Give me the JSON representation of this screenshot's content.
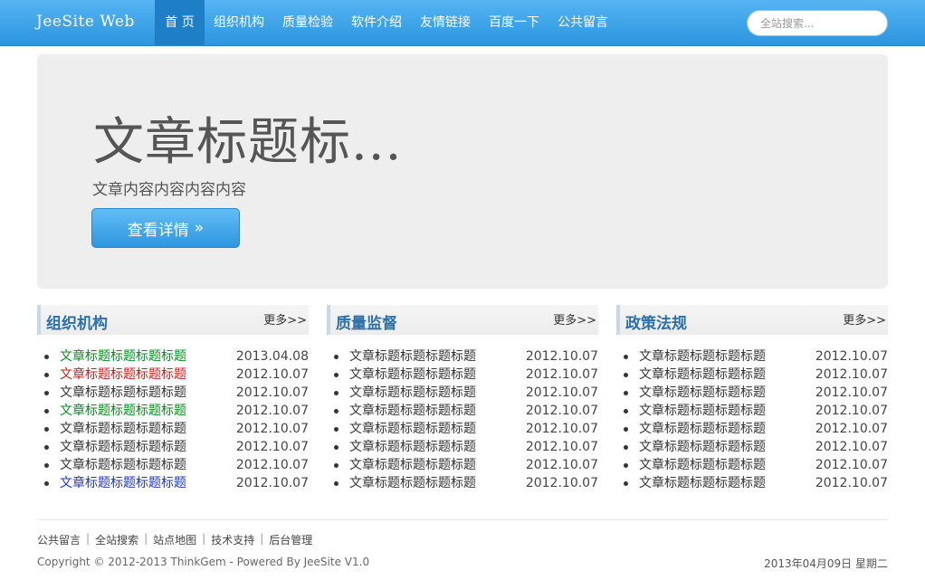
{
  "navbar": {
    "brand": "JeeSite Web",
    "items": [
      {
        "label": "首 页",
        "active": true
      },
      {
        "label": "组织机构"
      },
      {
        "label": "质量检验"
      },
      {
        "label": "软件介绍"
      },
      {
        "label": "友情链接"
      },
      {
        "label": "百度一下"
      },
      {
        "label": "公共留言"
      }
    ],
    "search_placeholder": "全站搜索..."
  },
  "hero": {
    "title": "文章标题标...",
    "text": "文章内容内容内容内容",
    "button_label": "查看详情",
    "button_arrow": "»"
  },
  "columns": [
    {
      "title": "组织机构",
      "more": "更多>>",
      "items": [
        {
          "title": "文章标题标题标题标题",
          "date": "2013.04.08",
          "color": "green"
        },
        {
          "title": "文章标题标题标题标题",
          "date": "2012.10.07",
          "color": "red"
        },
        {
          "title": "文章标题标题标题标题",
          "date": "2012.10.07",
          "color": ""
        },
        {
          "title": "文章标题标题标题标题",
          "date": "2012.10.07",
          "color": "green"
        },
        {
          "title": "文章标题标题标题标题",
          "date": "2012.10.07",
          "color": ""
        },
        {
          "title": "文章标题标题标题标题",
          "date": "2012.10.07",
          "color": ""
        },
        {
          "title": "文章标题标题标题标题",
          "date": "2012.10.07",
          "color": ""
        },
        {
          "title": "文章标题标题标题标题",
          "date": "2012.10.07",
          "color": "blue"
        }
      ]
    },
    {
      "title": "质量监督",
      "more": "更多>>",
      "items": [
        {
          "title": "文章标题标题标题标题",
          "date": "2012.10.07",
          "color": ""
        },
        {
          "title": "文章标题标题标题标题",
          "date": "2012.10.07",
          "color": ""
        },
        {
          "title": "文章标题标题标题标题",
          "date": "2012.10.07",
          "color": ""
        },
        {
          "title": "文章标题标题标题标题",
          "date": "2012.10.07",
          "color": ""
        },
        {
          "title": "文章标题标题标题标题",
          "date": "2012.10.07",
          "color": ""
        },
        {
          "title": "文章标题标题标题标题",
          "date": "2012.10.07",
          "color": ""
        },
        {
          "title": "文章标题标题标题标题",
          "date": "2012.10.07",
          "color": ""
        },
        {
          "title": "文章标题标题标题标题",
          "date": "2012.10.07",
          "color": ""
        }
      ]
    },
    {
      "title": "政策法规",
      "more": "更多>>",
      "items": [
        {
          "title": "文章标题标题标题标题",
          "date": "2012.10.07",
          "color": ""
        },
        {
          "title": "文章标题标题标题标题",
          "date": "2012.10.07",
          "color": ""
        },
        {
          "title": "文章标题标题标题标题",
          "date": "2012.10.07",
          "color": ""
        },
        {
          "title": "文章标题标题标题标题",
          "date": "2012.10.07",
          "color": ""
        },
        {
          "title": "文章标题标题标题标题",
          "date": "2012.10.07",
          "color": ""
        },
        {
          "title": "文章标题标题标题标题",
          "date": "2012.10.07",
          "color": ""
        },
        {
          "title": "文章标题标题标题标题",
          "date": "2012.10.07",
          "color": ""
        },
        {
          "title": "文章标题标题标题标题",
          "date": "2012.10.07",
          "color": ""
        }
      ]
    }
  ],
  "footer": {
    "links": [
      "公共留言",
      "全站搜索",
      "站点地图",
      "技术支持",
      "后台管理"
    ],
    "separator": "|",
    "copyright": "Copyright © 2012-2013 ThinkGem - Powered By JeeSite V1.0",
    "date": "2013年04月09日 星期二"
  },
  "colors": {
    "nav_top": "#55b4f3",
    "nav_bottom": "#2c95de",
    "nav_active": "#1f7fc6",
    "column_title": "#2d6fa8",
    "green": "#0a8a22",
    "red": "#c81c1c",
    "blue": "#2038b0"
  }
}
